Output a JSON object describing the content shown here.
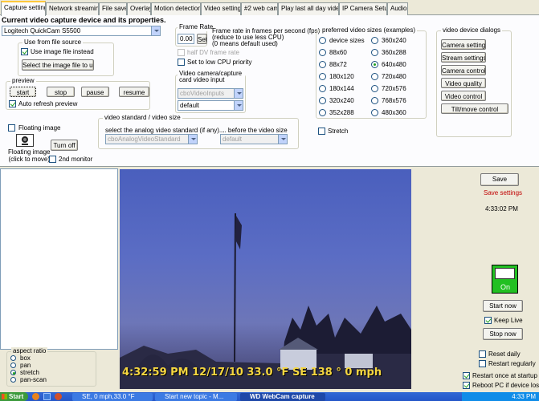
{
  "tabs": [
    "Capture settings",
    "Network streaming",
    "File save",
    "Overlay",
    "Motion detection",
    "Video settings",
    "#2 web cam",
    "Play last all day video",
    "IP Camera Setup",
    "Audio"
  ],
  "heading": "Current video capture device and its properties.",
  "device": "Logitech QuickCam S5500",
  "file_source": {
    "title": "Use from file source",
    "checkbox": "Use image file instead",
    "button": "Select the image file to use"
  },
  "preview": {
    "title": "preview",
    "start": "start",
    "stop": "stop",
    "pause": "pause",
    "resume": "resume",
    "auto_refresh": "Auto refresh preview"
  },
  "floating": {
    "checkbox": "Floating image",
    "icon_label": "Floating image\n(click to move)",
    "turn_off": "Turn off",
    "second_monitor": "2nd monitor"
  },
  "frame_rate": {
    "title": "Frame Rate",
    "value": "0.00",
    "set": "Set",
    "desc": "Frame rate in frames per second (fps)\n(reduce to use less CPU)\n(0 means default used)",
    "half_dv": "half DV frame rate",
    "low_cpu": "Set to low CPU priority"
  },
  "video_input": {
    "title": "Video camera/capture card video input",
    "combo1": "cboVideoInputs",
    "combo2": "default"
  },
  "video_standard": {
    "title": "video standard / video size",
    "label1": "select the analog video standard (if any)...",
    "label2": "... before the video size",
    "combo1": "cboAnalogVideoStandard",
    "combo2": "default"
  },
  "sizes": {
    "title": "preferred video sizes (examples)",
    "left": [
      "device sizes",
      "88x60",
      "88x72",
      "180x120",
      "180x144",
      "320x240",
      "352x288"
    ],
    "right": [
      "360x240",
      "360x288",
      "640x480",
      "720x480",
      "720x576",
      "768x576",
      "480x360"
    ],
    "selected": "640x480",
    "stretch": "Stretch"
  },
  "dialogs": {
    "title": "video device dialogs",
    "buttons": [
      "Camera settings",
      "Stream settings",
      "Camera control",
      "Video quality",
      "Video control",
      "Tilt/move control"
    ]
  },
  "right": {
    "save": "Save",
    "save_settings": "Save settings",
    "time": "4:33:02 PM",
    "on": "On",
    "start_now": "Start now",
    "keep_live": "Keep Live",
    "stop_now": "Stop now",
    "reset_daily": "Reset daily",
    "restart_regularly": "Restart regularly",
    "restart_startup": "Restart once at startup",
    "reboot": "Reboot PC if device lost"
  },
  "aspect": {
    "title": "aspect ratio",
    "options": [
      "box",
      "pan",
      "stretch",
      "pan-scan"
    ],
    "selected": "stretch"
  },
  "overlay": "4:32:59 PM  12/17/10 33.0 °F  SE  138 °  0 mph",
  "taskbar": {
    "start": "Start",
    "item1": "SE, 0 mph,33.0 °F",
    "item2": "Start new topic - M...",
    "item3": "WD WebCam capture",
    "clock": "4:33 PM"
  },
  "colors": {
    "on_green": "#22c022",
    "save_red": "#c00000",
    "overlay_yellow": "#f5d640"
  }
}
